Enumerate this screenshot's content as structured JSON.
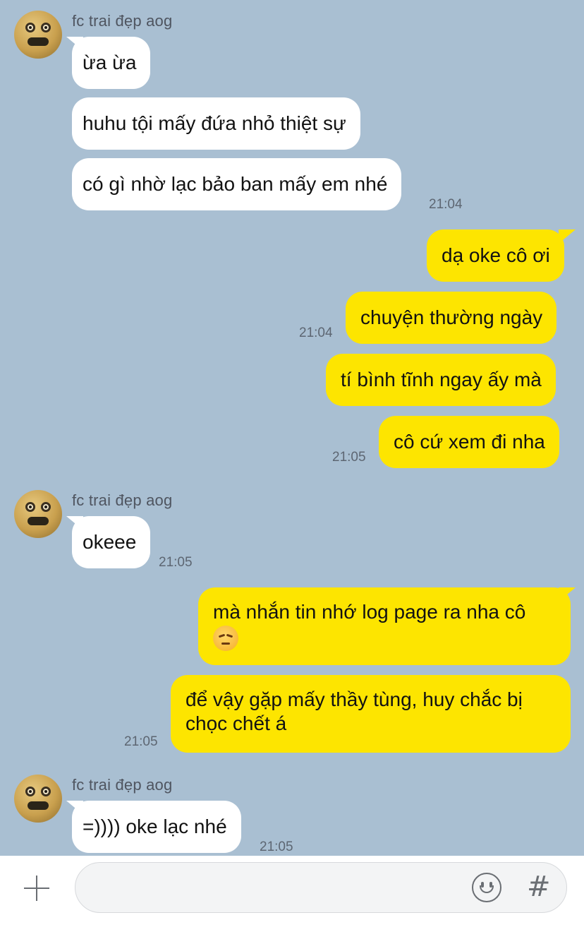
{
  "chat": {
    "groups": [
      {
        "sender": "fc trai đẹp aog",
        "messages": [
          "ừa ừa",
          "huhu tội mấy đứa nhỏ thiệt sự",
          "có gì nhờ lạc bảo ban mấy em nhé"
        ],
        "time": "21:04"
      },
      {
        "outgoing": [
          "dạ oke cô ơi",
          "chuyện thường ngày",
          "tí bình tĩnh ngay ấy mà",
          "cô cứ xem đi nha"
        ],
        "time_1": "21:04",
        "time_2": "21:05"
      },
      {
        "sender": "fc trai đẹp aog",
        "messages": [
          "okeee"
        ],
        "time": "21:05"
      },
      {
        "outgoing": [
          "mà nhắn tin nhớ log page ra nha cô",
          "để vậy gặp mấy thầy tùng, huy chắc bị chọc chết á"
        ],
        "emoji": "pensive-face",
        "time": "21:05"
      },
      {
        "sender": "fc trai đẹp aog",
        "messages": [
          "=)))) oke lạc nhé"
        ],
        "time": "21:05"
      }
    ]
  },
  "input_bar": {
    "plus_icon": "plus-icon",
    "message_placeholder": "",
    "emoji_icon": "smiley-icon",
    "hash_label": "#"
  },
  "colors": {
    "background": "#a9bfd2",
    "incoming_bubble": "#ffffff",
    "outgoing_bubble": "#fde500"
  }
}
